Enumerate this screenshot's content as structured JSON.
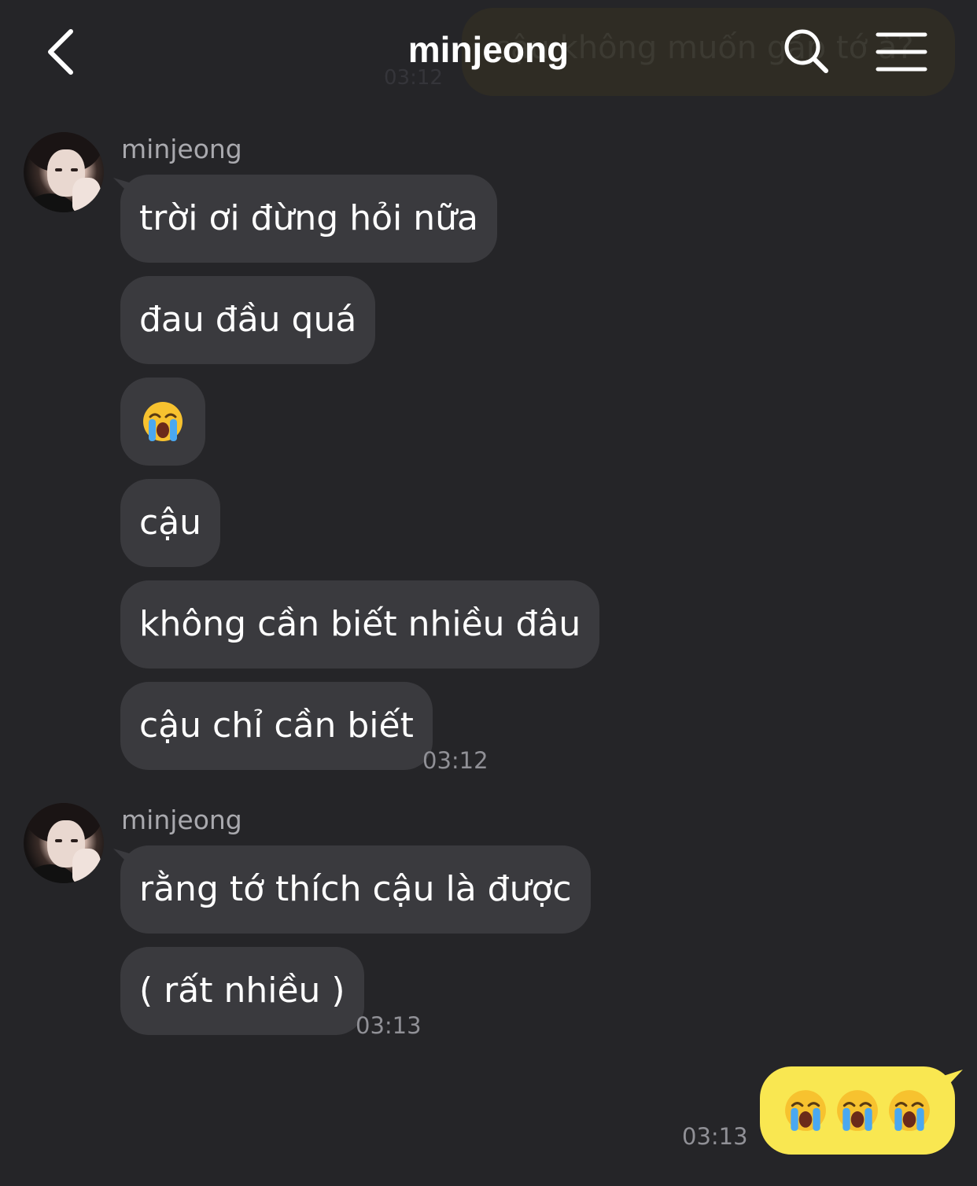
{
  "header": {
    "title": "minjeong",
    "icons": {
      "back": "chevron-left-icon",
      "search": "search-icon",
      "menu": "hamburger-menu-icon"
    }
  },
  "ghost_message": {
    "text": "cậu không muốn gặp tớ à?",
    "time": "03:12"
  },
  "groups": [
    {
      "sender": "minjeong",
      "messages": [
        "trời ơi đừng hỏi nữa",
        "đau đầu quá",
        "😭",
        "cậu",
        "không cần biết nhiều đâu",
        "cậu chỉ cần biết"
      ],
      "time": "03:12"
    },
    {
      "sender": "minjeong",
      "messages": [
        "rằng tớ thích cậu là được",
        "( rất nhiều )"
      ],
      "time": "03:13"
    }
  ],
  "outgoing": {
    "text": "😭😭😭",
    "time": "03:13"
  },
  "colors": {
    "background": "#252528",
    "incoming_bubble": "#3a3a3e",
    "outgoing_bubble": "#f9e751",
    "timestamp": "#909096",
    "sender_name": "#a9a9ae"
  }
}
